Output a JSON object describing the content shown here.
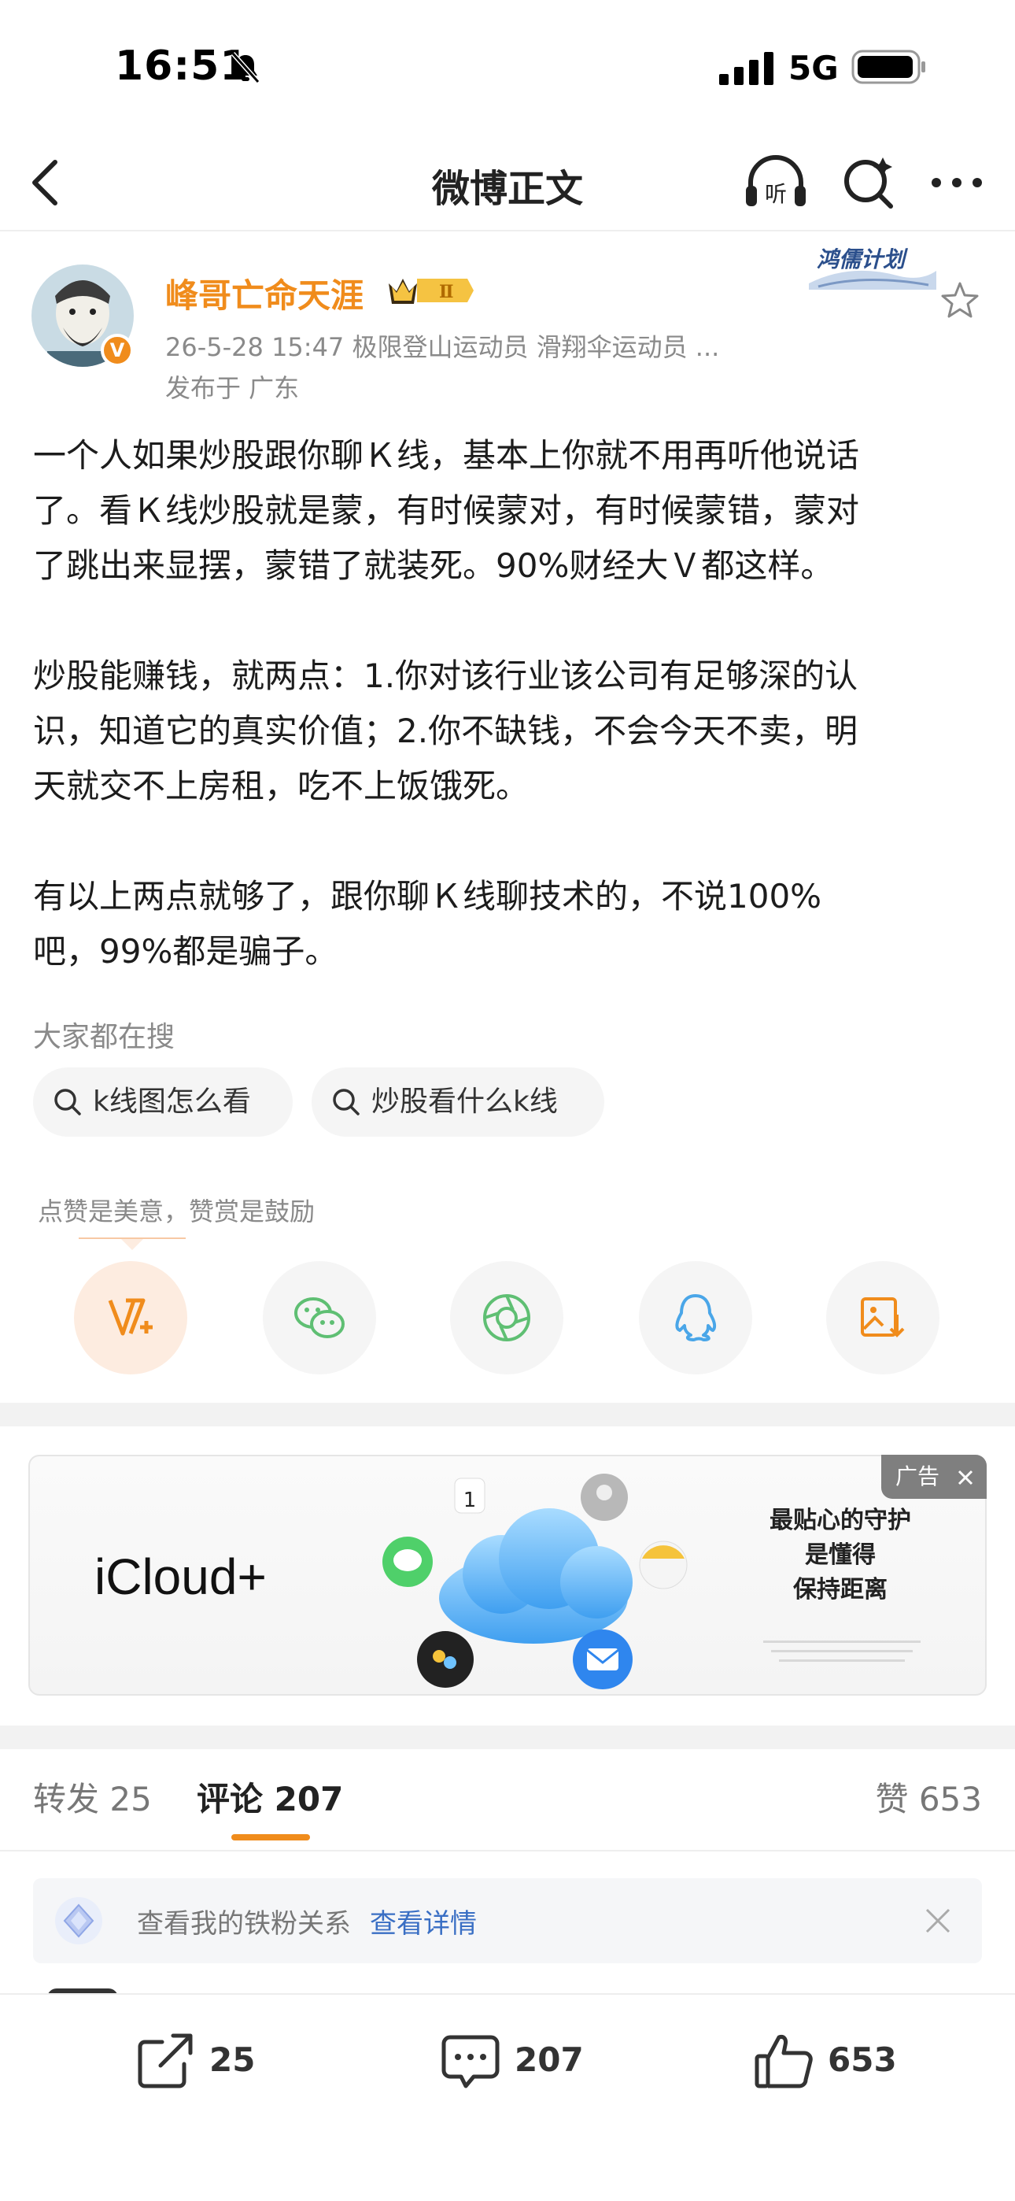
{
  "status_bar": {
    "time": "16:51",
    "network": "5G",
    "icons": [
      "bell-off-icon",
      "signal-icon",
      "battery-icon"
    ]
  },
  "nav": {
    "title": "微博正文",
    "icons": [
      "back-icon",
      "listen-icon",
      "search-icon",
      "more-icon"
    ],
    "listen_label": "听"
  },
  "author": {
    "name": "峰哥亡命天涯",
    "level_badge": "Ⅱ",
    "verified_mark": "V",
    "campaign_badge": "鸿儒计划",
    "meta": "26-5-28 15:47  极限登山运动员 滑翔伞运动员 ...",
    "location": "发布于 广东"
  },
  "post": {
    "paragraphs": [
      [
        "一个人如果炒股跟你聊Ｋ线，基本上你就不用再听他说话",
        "了。看Ｋ线炒股就是蒙，有时候蒙对，有时候蒙错，蒙对",
        "了跳出来显摆，蒙错了就装死。90%财经大Ｖ都这样。"
      ],
      [
        "炒股能赚钱，就两点：1.你对该行业该公司有足够深的认",
        "识，知道它的真实价值；2.你不缺钱，不会今天不卖，明",
        "天就交不上房租，吃不上饭饿死。"
      ],
      [
        "有以上两点就够了，跟你聊Ｋ线聊技术的，不说100%",
        "吧，99%都是骗子。"
      ]
    ]
  },
  "hot_search": {
    "title": "大家都在搜",
    "chips": [
      "k线图怎么看",
      "炒股看什么k线"
    ]
  },
  "reward": {
    "hint": "点赞是美意，赞赏是鼓励",
    "share_buttons": [
      "reward-icon",
      "wechat-icon",
      "moments-icon",
      "qq-icon",
      "save-image-icon"
    ]
  },
  "ad": {
    "tag": "广告",
    "brand": "iCloud+",
    "calendar_day": "1",
    "slogan_lines": [
      "最贴心的守护",
      "是懂得",
      "保持距离"
    ]
  },
  "tabs": {
    "repost_label": "转发",
    "repost_count": "25",
    "comment_label": "评论",
    "comment_count": "207",
    "like_label": "赞",
    "like_count": "653"
  },
  "fan_bar": {
    "text": "查看我的铁粉关系",
    "link": "查看详情"
  },
  "bottom_bar": {
    "repost_count": "25",
    "comment_count": "207",
    "like_count": "653"
  },
  "colors": {
    "accent_orange": "#f08c1c",
    "link_blue": "#3a6fc4",
    "wechat_green": "#5fbf73",
    "qq_blue": "#4aa6e8"
  }
}
